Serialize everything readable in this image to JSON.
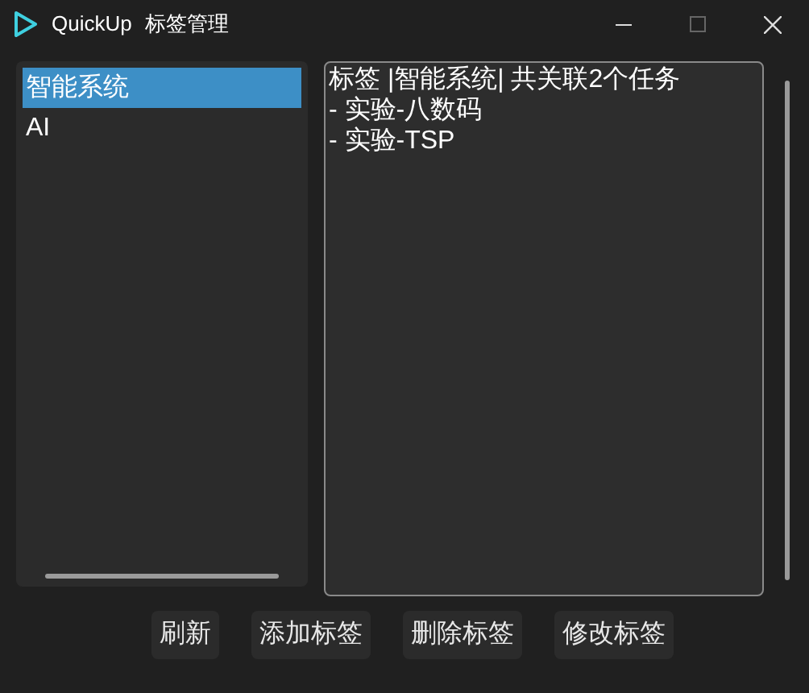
{
  "window": {
    "app_name": "QuickUp",
    "title": "标签管理"
  },
  "tag_list": [
    {
      "label": "智能系统",
      "selected": true
    },
    {
      "label": "AI",
      "selected": false
    }
  ],
  "details": {
    "lines": [
      "标签 |智能系统| 共关联2个任务",
      "- 实验-八数码",
      "- 实验-TSP"
    ]
  },
  "buttons": [
    "刷新",
    "添加标签",
    "删除标签",
    "修改标签"
  ]
}
